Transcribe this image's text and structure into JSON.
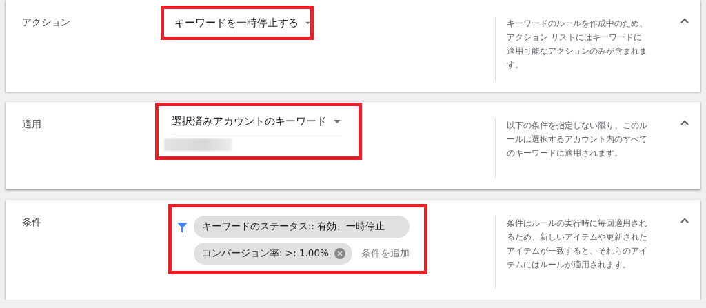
{
  "sections": [
    {
      "label": "アクション",
      "kind": "dropdown",
      "value": "キーワードを一時停止する",
      "expanded": true,
      "description": "キーワードのルールを作成中のため、アクション リストにはキーワードに適用可能なアクションのみが含まれます。"
    },
    {
      "label": "適用",
      "kind": "scope",
      "value": "選択済みアカウントのキーワード",
      "expanded": true,
      "description": "以下の条件を指定しない限り、このルールは選択するアカウント内のすべてのキーワードに適用されます。"
    },
    {
      "label": "条件",
      "kind": "conditions",
      "chips": [
        {
          "text": "キーワードのステータス:: 有効、一時停止",
          "removable": false
        },
        {
          "text": "コンバージョン率: >: 1.00%",
          "removable": true
        }
      ],
      "add_link": "条件を追加",
      "expanded": true,
      "description": "条件はルールの実行時に毎回適用されるため、新しいアイテムや更新されたアイテムが一致すると、それらのアイテムにはルールが適用されます。"
    }
  ]
}
